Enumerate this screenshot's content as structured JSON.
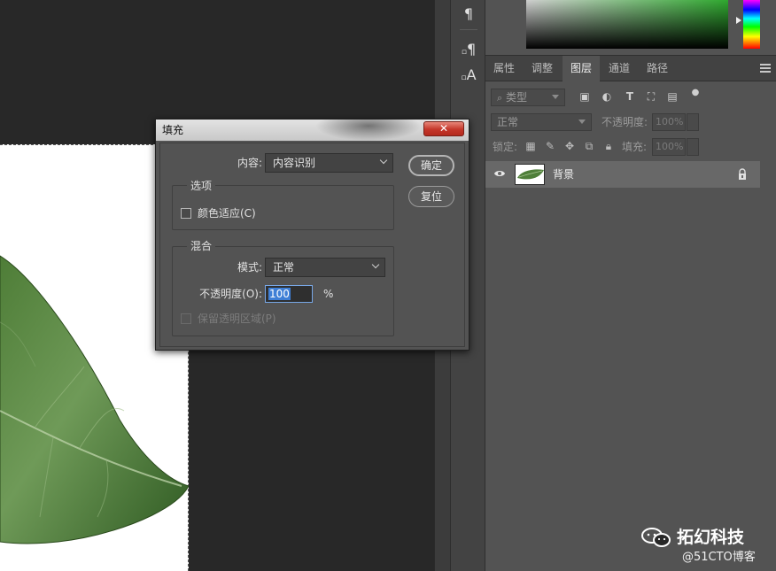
{
  "tool_strip": {
    "icons": [
      "paragraph-icon",
      "paragraph-style-icon",
      "character-style-icon"
    ],
    "paragraph_glyph": "¶",
    "paragraph_style_glyph": "¶",
    "character_style_glyph": "A"
  },
  "layers_panel": {
    "tabs": [
      {
        "label": "属性"
      },
      {
        "label": "调整"
      },
      {
        "label": "图层",
        "active": true
      },
      {
        "label": "通道"
      },
      {
        "label": "路径"
      }
    ],
    "filter_kind": "类型",
    "blend_mode": "正常",
    "opacity_label": "不透明度:",
    "opacity_value": "100%",
    "lock_label": "锁定:",
    "fill_label": "填充:",
    "fill_value": "100%",
    "layers": [
      {
        "name": "背景",
        "visible": true,
        "locked": true
      }
    ]
  },
  "fill_dialog": {
    "title": "填充",
    "close_label": "✕",
    "content_label": "内容:",
    "content_value": "内容识别",
    "ok_label": "确定",
    "reset_label": "复位",
    "options_group": "选项",
    "color_adapt_label": "颜色适应(C)",
    "color_adapt_checked": false,
    "blend_group": "混合",
    "mode_label": "模式:",
    "mode_value": "正常",
    "opacity_label": "不透明度(O):",
    "opacity_value": "100",
    "opacity_unit": "%",
    "preserve_transparency_label": "保留透明区域(P)",
    "preserve_transparency_enabled": false
  },
  "watermark": {
    "brand": "拓幻科技",
    "credit": "@51CTO博客"
  },
  "colors": {
    "panel_bg": "#535353",
    "canvas_bg": "#282828",
    "highlight_blue": "#3f7fd6",
    "close_red": "#c4362a"
  }
}
